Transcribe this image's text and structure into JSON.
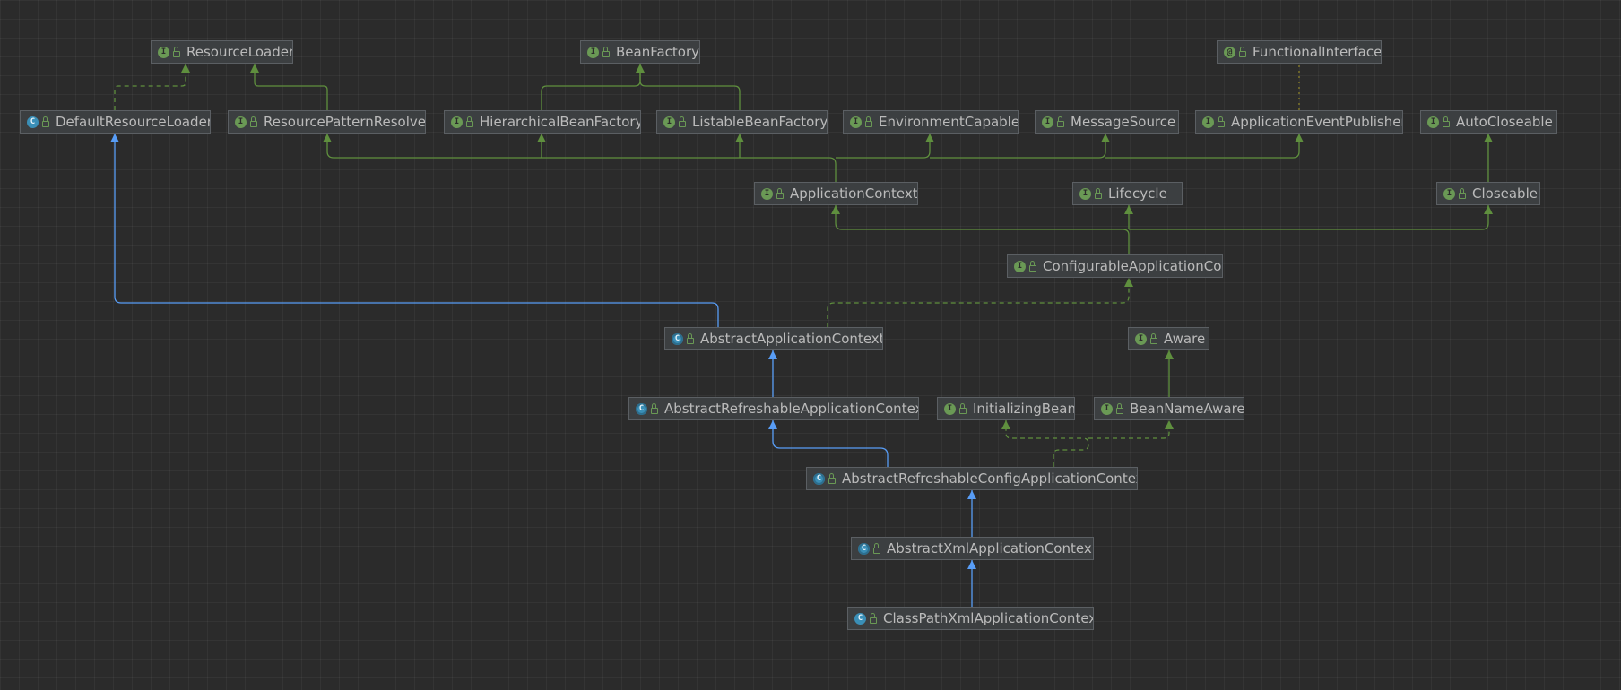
{
  "diagram": {
    "nodes": [
      {
        "id": "ResourceLoader",
        "label": "ResourceLoader",
        "kind": "interface"
      },
      {
        "id": "BeanFactory",
        "label": "BeanFactory",
        "kind": "interface"
      },
      {
        "id": "FunctionalInterface",
        "label": "FunctionalInterface",
        "kind": "annotation"
      },
      {
        "id": "DefaultResourceLoader",
        "label": "DefaultResourceLoader",
        "kind": "class"
      },
      {
        "id": "ResourcePatternResolver",
        "label": "ResourcePatternResolve",
        "kind": "interface"
      },
      {
        "id": "HierarchicalBeanFactory",
        "label": "HierarchicalBeanFactory",
        "kind": "interface"
      },
      {
        "id": "ListableBeanFactory",
        "label": "ListableBeanFactory",
        "kind": "interface"
      },
      {
        "id": "EnvironmentCapable",
        "label": "EnvironmentCapable",
        "kind": "interface"
      },
      {
        "id": "MessageSource",
        "label": "MessageSource",
        "kind": "interface"
      },
      {
        "id": "ApplicationEventPublisher",
        "label": "ApplicationEventPublisher",
        "kind": "interface"
      },
      {
        "id": "AutoCloseable",
        "label": "AutoCloseable",
        "kind": "interface"
      },
      {
        "id": "ApplicationContext",
        "label": "ApplicationContext",
        "kind": "interface"
      },
      {
        "id": "Lifecycle",
        "label": "Lifecycle",
        "kind": "interface"
      },
      {
        "id": "Closeable",
        "label": "Closeable",
        "kind": "interface"
      },
      {
        "id": "ConfigurableApplicationContext",
        "label": "ConfigurableApplicationContex",
        "kind": "interface"
      },
      {
        "id": "AbstractApplicationContext",
        "label": "AbstractApplicationContext",
        "kind": "abstract"
      },
      {
        "id": "Aware",
        "label": "Aware",
        "kind": "interface"
      },
      {
        "id": "AbstractRefreshableApplicationContext",
        "label": "AbstractRefreshableApplicationContex",
        "kind": "abstract"
      },
      {
        "id": "InitializingBean",
        "label": "InitializingBean",
        "kind": "interface"
      },
      {
        "id": "BeanNameAware",
        "label": "BeanNameAware",
        "kind": "interface"
      },
      {
        "id": "AbstractRefreshableConfigApplicationContext",
        "label": "AbstractRefreshableConfigApplicationContex",
        "kind": "abstract"
      },
      {
        "id": "AbstractXmlApplicationContext",
        "label": "AbstractXmlApplicationContex",
        "kind": "abstract"
      },
      {
        "id": "ClassPathXmlApplicationContext",
        "label": "ClassPathXmlApplicationContext",
        "kind": "class"
      }
    ],
    "edges": [
      {
        "from": "DefaultResourceLoader",
        "to": "ResourceLoader",
        "type": "implements"
      },
      {
        "from": "ResourcePatternResolver",
        "to": "ResourceLoader",
        "type": "extends-interface"
      },
      {
        "from": "HierarchicalBeanFactory",
        "to": "BeanFactory",
        "type": "extends-interface"
      },
      {
        "from": "ListableBeanFactory",
        "to": "BeanFactory",
        "type": "extends-interface"
      },
      {
        "from": "ApplicationEventPublisher",
        "to": "FunctionalInterface",
        "type": "annotated"
      },
      {
        "from": "ApplicationContext",
        "to": "ResourcePatternResolver",
        "type": "extends-interface"
      },
      {
        "from": "ApplicationContext",
        "to": "HierarchicalBeanFactory",
        "type": "extends-interface"
      },
      {
        "from": "ApplicationContext",
        "to": "ListableBeanFactory",
        "type": "extends-interface"
      },
      {
        "from": "ApplicationContext",
        "to": "EnvironmentCapable",
        "type": "extends-interface"
      },
      {
        "from": "ApplicationContext",
        "to": "MessageSource",
        "type": "extends-interface"
      },
      {
        "from": "ApplicationContext",
        "to": "ApplicationEventPublisher",
        "type": "extends-interface"
      },
      {
        "from": "Closeable",
        "to": "AutoCloseable",
        "type": "extends-interface"
      },
      {
        "from": "ConfigurableApplicationContext",
        "to": "ApplicationContext",
        "type": "extends-interface"
      },
      {
        "from": "ConfigurableApplicationContext",
        "to": "Lifecycle",
        "type": "extends-interface"
      },
      {
        "from": "ConfigurableApplicationContext",
        "to": "Closeable",
        "type": "extends-interface"
      },
      {
        "from": "AbstractApplicationContext",
        "to": "ConfigurableApplicationContext",
        "type": "implements"
      },
      {
        "from": "AbstractApplicationContext",
        "to": "DefaultResourceLoader",
        "type": "extends-class"
      },
      {
        "from": "BeanNameAware",
        "to": "Aware",
        "type": "extends-interface"
      },
      {
        "from": "AbstractRefreshableApplicationContext",
        "to": "AbstractApplicationContext",
        "type": "extends-class"
      },
      {
        "from": "AbstractRefreshableConfigApplicationContext",
        "to": "AbstractRefreshableApplicationContext",
        "type": "extends-class"
      },
      {
        "from": "AbstractRefreshableConfigApplicationContext",
        "to": "InitializingBean",
        "type": "implements"
      },
      {
        "from": "AbstractRefreshableConfigApplicationContext",
        "to": "BeanNameAware",
        "type": "implements"
      },
      {
        "from": "AbstractXmlApplicationContext",
        "to": "AbstractRefreshableConfigApplicationContext",
        "type": "extends-class"
      },
      {
        "from": "ClassPathXmlApplicationContext",
        "to": "AbstractXmlApplicationContext",
        "type": "extends-class"
      }
    ],
    "colors": {
      "background": "#2b2b2b",
      "node_fill": "#3c3f41",
      "node_border": "#5b5f63",
      "node_text": "#bbbbbb",
      "interface_green": "#6a9955",
      "class_blue": "#3a8fb7",
      "extends_class_edge": "#589df6",
      "interface_edge": "#5f8f3e",
      "annotation_edge": "#8a7f28"
    }
  }
}
